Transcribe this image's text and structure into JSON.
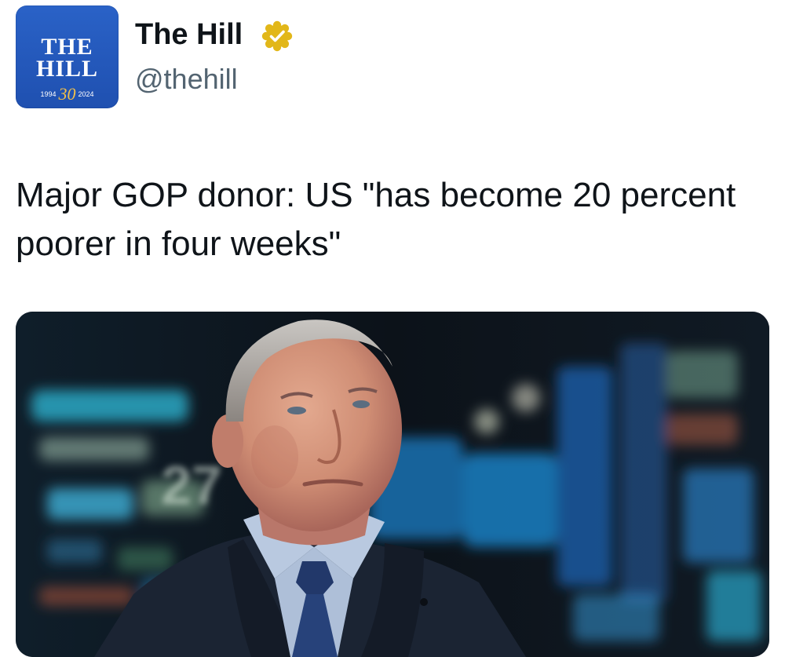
{
  "account": {
    "name": "The Hill",
    "handle": "@thehill",
    "verified": true,
    "verified_badge_color": "#e2b719",
    "avatar": {
      "line1": "THE",
      "line2": "HILL",
      "year_start": "1994",
      "year_mark": "30",
      "year_end": "2024",
      "bg_color": "#2457bd",
      "accent_color": "#f2c04a"
    }
  },
  "tweet": {
    "text": "Major GOP donor: US \"has become 20 percent poorer in four weeks\""
  },
  "media": {
    "type": "photo",
    "background_display_text": "27"
  }
}
